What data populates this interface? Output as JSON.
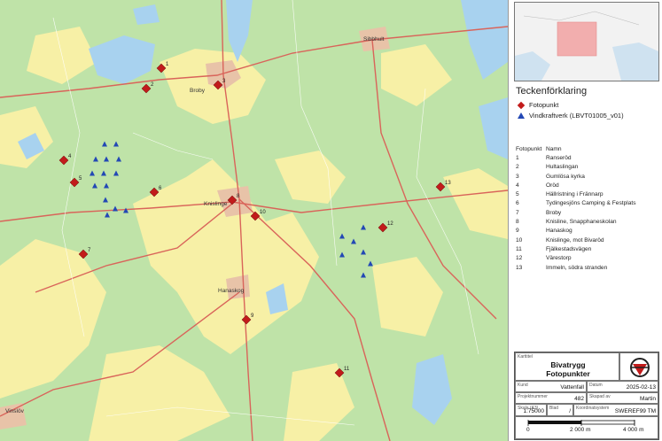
{
  "map": {
    "place_names": {
      "broby": "Broby",
      "knislinge": "Knislinge",
      "hanaskog": "Hanaskog",
      "vinslov": "Vinslöv",
      "sibbhult": "Sibbhult"
    },
    "colors": {
      "forest": "#bfe3a8",
      "farmland": "#f7f0a6",
      "water": "#a8d2ef",
      "urban": "#e8c3a8",
      "road": "#d9645a",
      "marker": "#c21b1b",
      "turbine": "#2348b5"
    },
    "photo_points": [
      "1",
      "2",
      "3",
      "4",
      "5",
      "6",
      "7",
      "8",
      "9",
      "10",
      "11",
      "12",
      "13"
    ],
    "wind_turbine_count": 21
  },
  "legend": {
    "title": "Teckenförklaring",
    "items": [
      {
        "label": "Fotopunkt",
        "icon": "red-diamond-icon"
      },
      {
        "label": "Vindkraftverk (LBVT01005_v01)",
        "icon": "blue-triangle-icon"
      }
    ]
  },
  "point_table": {
    "headers": [
      "Fotopunkt",
      "Namn"
    ],
    "rows": [
      [
        "1",
        "Ranseröd"
      ],
      [
        "2",
        "Hultaslingan"
      ],
      [
        "3",
        "Gumlösa kyrka"
      ],
      [
        "4",
        "Oröd"
      ],
      [
        "5",
        "Hällristning i Frännarp"
      ],
      [
        "6",
        "Tydingesjöns Camping & Festplats"
      ],
      [
        "7",
        "Broby"
      ],
      [
        "8",
        "Knisline, Snapphaneskolan"
      ],
      [
        "9",
        "Hanaskog"
      ],
      [
        "10",
        "Knislinge, mot Bivaröd"
      ],
      [
        "11",
        "Fjälkestadsvägen"
      ],
      [
        "12",
        "Värestorp"
      ],
      [
        "13",
        "Immeln, södra stranden"
      ]
    ]
  },
  "title_block": {
    "kartitel_label": "Karttitel",
    "title_line1": "Bivatrygg",
    "title_line2": "Fotopunkter",
    "kund_label": "Kund",
    "kund": "Vattenfall",
    "datum_label": "Datum",
    "datum": "2025-02-13",
    "projektnummer_label": "Projektnummer",
    "projektnummer": "482",
    "skapad_label": "Skapad av",
    "skapad": "Martin",
    "skala_label": "Skala (A3)",
    "skala": "1:75000",
    "blad_label": "Blad",
    "blad": "/",
    "koord_label": "Koordinatsystem",
    "koord": "SWEREF99 TM",
    "scale_ticks": [
      "0",
      "2 000 m",
      "4 000 m"
    ]
  }
}
